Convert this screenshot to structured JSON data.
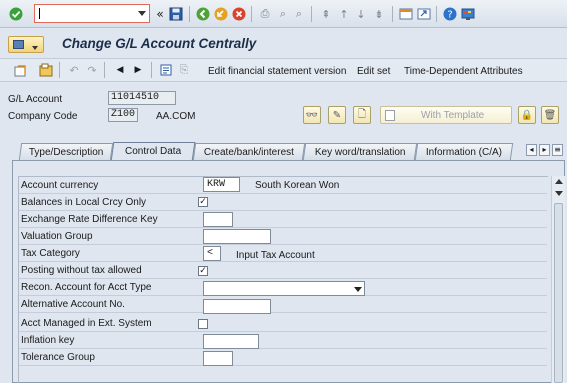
{
  "colors": {
    "background": "#dfe6ef",
    "title": "#1b2e49",
    "command_border": "#e06b5b",
    "toolbar_bg": "#e4eaf1"
  },
  "system_toolbar": {
    "command_field": "",
    "icons": [
      "enter-icon",
      "command-dropdown-icon",
      "collapse-icon",
      "save-icon",
      "back-icon",
      "exit-icon",
      "cancel-icon",
      "print-icon",
      "find-icon",
      "find-next-icon",
      "first-page-icon",
      "previous-page-icon",
      "next-page-icon",
      "last-page-icon",
      "create-session-icon",
      "shortcut-icon",
      "help-icon",
      "customize-layout-icon"
    ]
  },
  "title": "Change G/L Account Centrally",
  "app_toolbar": {
    "edit_fs_version": "Edit financial statement version",
    "edit_set": "Edit set",
    "time_dependent": "Time-Dependent Attributes"
  },
  "header": {
    "gl_account_label": "G/L Account",
    "gl_account_value": "11014510",
    "company_code_label": "Company Code",
    "company_code_value": "Z100",
    "company_name": "AA.COM",
    "with_template_label": "With Template"
  },
  "tabs": [
    {
      "label": "Type/Description",
      "active": false
    },
    {
      "label": "Control Data",
      "active": true
    },
    {
      "label": "Create/bank/interest",
      "active": false
    },
    {
      "label": "Key word/translation",
      "active": false
    },
    {
      "label": "Information (C/A)",
      "active": false
    }
  ],
  "form": {
    "account_currency": {
      "label": "Account currency",
      "value": "KRW",
      "desc": "South Korean Won"
    },
    "balances_local": {
      "label": "Balances in Local Crcy Only",
      "checked": "✓"
    },
    "exchange_rate_key": {
      "label": "Exchange Rate Difference Key",
      "value": ""
    },
    "valuation_group": {
      "label": "Valuation Group",
      "value": ""
    },
    "tax_category": {
      "label": "Tax Category",
      "value": "<",
      "desc": "Input Tax Account"
    },
    "posting_without_tax": {
      "label": "Posting without tax allowed",
      "checked": "✓"
    },
    "recon_account": {
      "label": "Recon. Account for Acct Type",
      "value": ""
    },
    "alternative_account": {
      "label": "Alternative Account No.",
      "value": ""
    },
    "acct_managed_ext": {
      "label": "Acct Managed in Ext. System",
      "checked": ""
    },
    "inflation_key": {
      "label": "Inflation key",
      "value": ""
    },
    "tolerance_group": {
      "label": "Tolerance Group",
      "value": ""
    }
  }
}
